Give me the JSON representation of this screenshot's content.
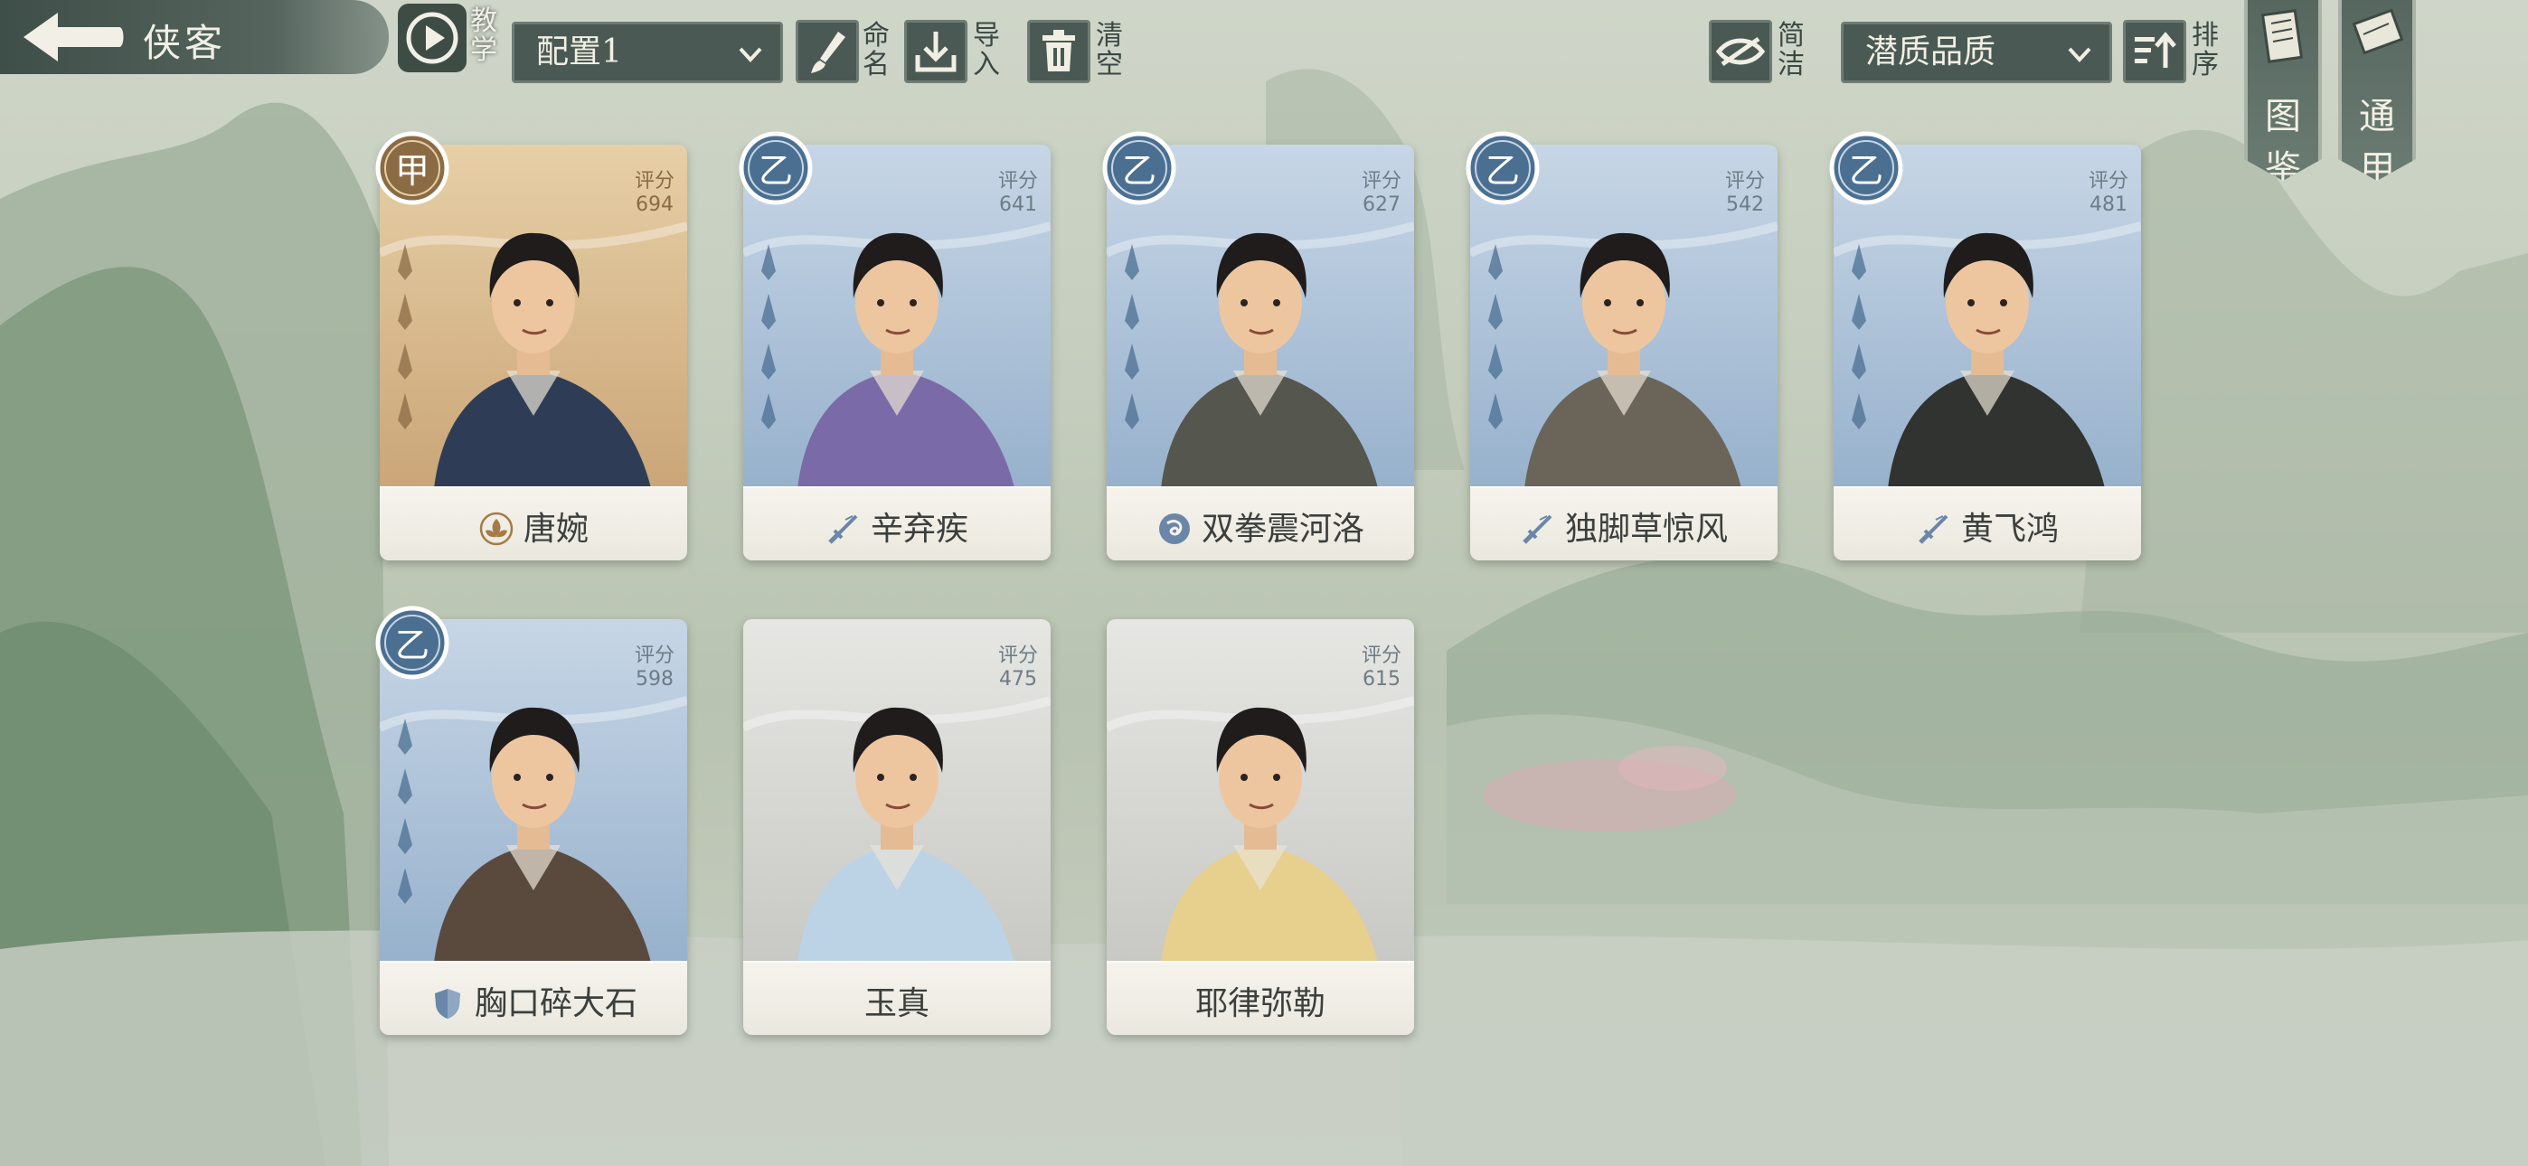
{
  "header": {
    "title": "侠客",
    "tutorial_label": "教学",
    "config_select": "配置1",
    "rename_label": "命名",
    "import_label": "导入",
    "clear_label": "清空",
    "simple_label": "简洁",
    "sort_select": "潜质品质",
    "sort_label": "排序",
    "codex_label": "图鉴",
    "general_label": "通用"
  },
  "cards": [
    {
      "name": "唐婉",
      "grade": "甲",
      "score_label": "评分",
      "score": "694",
      "skill_icon": "lotus-icon",
      "tier": "gold"
    },
    {
      "name": "辛弃疾",
      "grade": "乙",
      "score_label": "评分",
      "score": "641",
      "skill_icon": "sword-icon",
      "tier": "blue"
    },
    {
      "name": "双拳震河洛",
      "grade": "乙",
      "score_label": "评分",
      "score": "627",
      "skill_icon": "swirl-icon",
      "tier": "blue"
    },
    {
      "name": "独脚草惊风",
      "grade": "乙",
      "score_label": "评分",
      "score": "542",
      "skill_icon": "sword-icon",
      "tier": "blue"
    },
    {
      "name": "黄飞鸿",
      "grade": "乙",
      "score_label": "评分",
      "score": "481",
      "skill_icon": "sword-icon",
      "tier": "blue"
    },
    {
      "name": "胸口碎大石",
      "grade": "乙",
      "score_label": "评分",
      "score": "598",
      "skill_icon": "shield-icon",
      "tier": "blue"
    },
    {
      "name": "玉真",
      "grade": "",
      "score_label": "评分",
      "score": "475",
      "skill_icon": "",
      "tier": "grey"
    },
    {
      "name": "耶律弥勒",
      "grade": "",
      "score_label": "评分",
      "score": "615",
      "skill_icon": "",
      "tier": "grey"
    }
  ],
  "colors": {
    "panel_dark": "#4a5953",
    "gold_card": "#d9b889",
    "blue_card": "#a9bfd6",
    "grey_card": "#d6d6d3"
  }
}
